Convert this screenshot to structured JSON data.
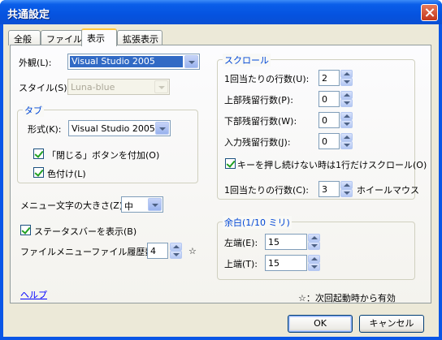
{
  "window": {
    "title": "共通設定"
  },
  "tabs": [
    "全般",
    "ファイル",
    "表示",
    "拡張表示"
  ],
  "active_tab": "表示",
  "appearance": {
    "label": "外観(L):",
    "value": "Visual Studio 2005"
  },
  "style": {
    "label": "スタイル(S):",
    "value": "Luna-blue"
  },
  "tab_group": {
    "title": "タブ",
    "format_label": "形式(K):",
    "format_value": "Visual Studio 2005",
    "close_button_label": "「閉じる」ボタンを付加(O)",
    "close_button_checked": true,
    "colorize_label": "色付け(L)",
    "colorize_checked": true
  },
  "menu_font": {
    "label": "メニュー文字の大きさ(Z):",
    "value": "中"
  },
  "statusbar": {
    "label": "ステータスバーを表示(B)",
    "checked": true
  },
  "file_history": {
    "label": "ファイルメニューファイル履歴数(I):",
    "value": "4",
    "star": "☆"
  },
  "scroll_group": {
    "title": "スクロール",
    "lines_per_scroll": {
      "label": "1回当たりの行数(U):",
      "value": "2"
    },
    "top_lines": {
      "label": "上部残留行数(P):",
      "value": "0"
    },
    "bottom_lines": {
      "label": "下部残留行数(W):",
      "value": "0"
    },
    "input_lines": {
      "label": "入力残留行数(J):",
      "value": "0"
    },
    "key_scroll": {
      "label": "キーを押し続けない時は1行だけスクロール(O)",
      "checked": true
    },
    "wheel_lines": {
      "label": "1回当たりの行数(C):",
      "value": "3",
      "suffix": "ホイールマウス"
    }
  },
  "margin_group": {
    "title": "余白(1/10 ミリ)",
    "left": {
      "label": "左端(E):",
      "value": "15"
    },
    "top": {
      "label": "上端(T):",
      "value": "15"
    }
  },
  "help_link": "ヘルプ",
  "footnote": "☆：次回起動時から有効",
  "buttons": {
    "ok": "OK",
    "cancel": "キャンセル"
  }
}
